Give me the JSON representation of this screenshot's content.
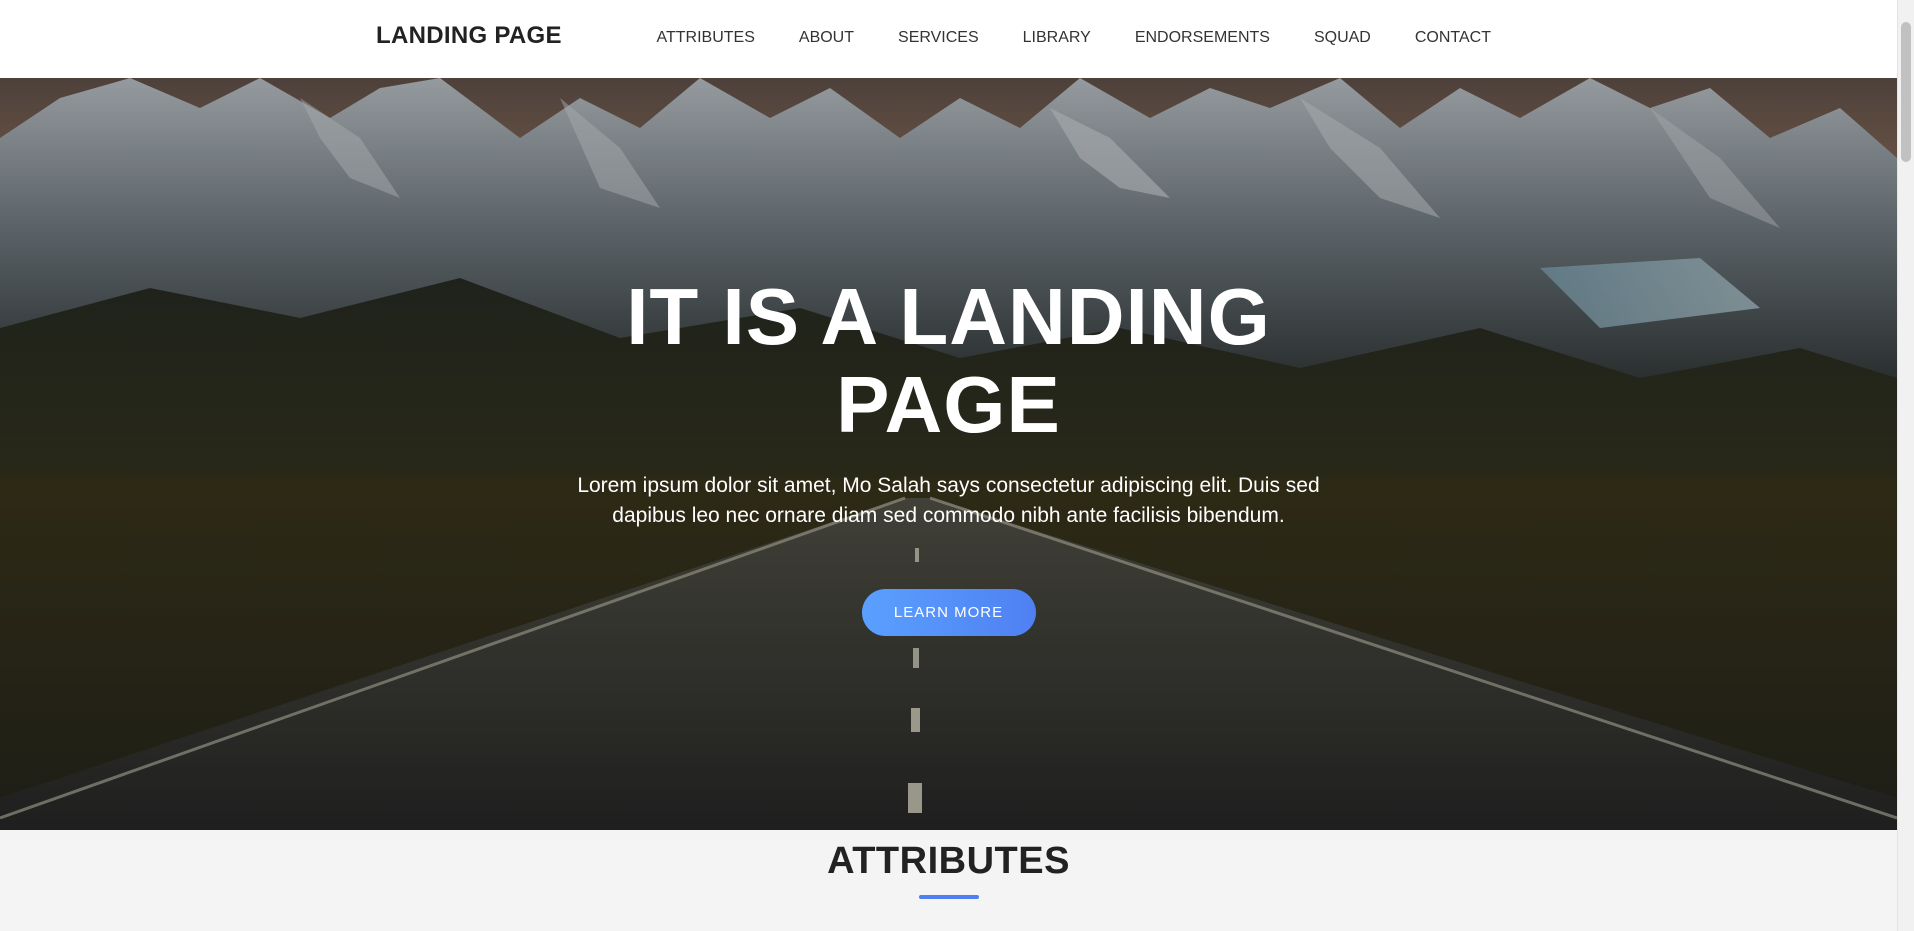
{
  "navbar": {
    "brand": "LANDING PAGE",
    "links": [
      "ATTRIBUTES",
      "ABOUT",
      "SERVICES",
      "LIBRARY",
      "ENDORSEMENTS",
      "SQUAD",
      "CONTACT"
    ]
  },
  "hero": {
    "title": "IT IS A LANDING PAGE",
    "text": "Lorem ipsum dolor sit amet, Mo Salah says consectetur adipiscing elit. Duis sed dapibus leo nec ornare diam sed commodo nibh ante facilisis bibendum.",
    "button_label": "LEARN MORE"
  },
  "attributes": {
    "title": "ATTRIBUTES"
  },
  "colors": {
    "accent": "#4f80f2",
    "accent_light": "#5aa0ff",
    "navbar_bg": "#ffffff",
    "section_bg": "#f4f4f4",
    "text_dark": "#222222"
  },
  "icons": {
    "background": "mountain-road-image"
  }
}
